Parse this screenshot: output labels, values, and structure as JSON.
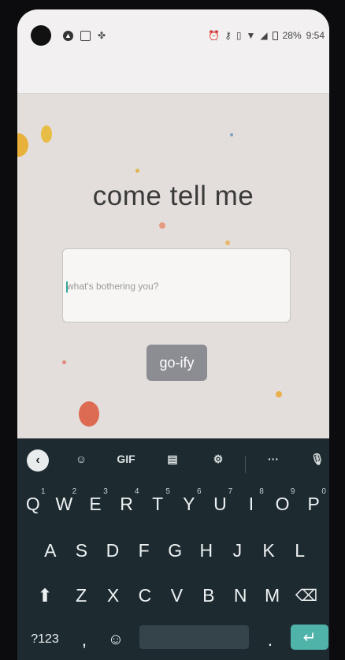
{
  "status_bar": {
    "battery": "28%",
    "time": "9:54",
    "left_icons": [
      "vpn-icon",
      "gallery-icon",
      "fan-icon"
    ],
    "right_icons": [
      "alarm-icon",
      "key-icon",
      "vibrate-icon",
      "wifi-icon",
      "signal-icon",
      "battery-icon"
    ]
  },
  "main": {
    "title": "come tell me",
    "input": {
      "placeholder": "what's bothering you?",
      "value": ""
    },
    "submit_label": "go-ify"
  },
  "keyboard": {
    "toolbar": [
      "back-icon",
      "sticker-icon",
      "GIF",
      "clipboard-icon",
      "gear-icon",
      "more-icon",
      "mic-icon"
    ],
    "gif_label": "GIF",
    "more_label": "···",
    "row1": [
      {
        "k": "Q",
        "n": "1"
      },
      {
        "k": "W",
        "n": "2"
      },
      {
        "k": "E",
        "n": "3"
      },
      {
        "k": "R",
        "n": "4"
      },
      {
        "k": "T",
        "n": "5"
      },
      {
        "k": "Y",
        "n": "6"
      },
      {
        "k": "U",
        "n": "7"
      },
      {
        "k": "I",
        "n": "8"
      },
      {
        "k": "O",
        "n": "9"
      },
      {
        "k": "P",
        "n": "0"
      }
    ],
    "row2": [
      "A",
      "S",
      "D",
      "F",
      "G",
      "H",
      "J",
      "K",
      "L"
    ],
    "row3": [
      "Z",
      "X",
      "C",
      "V",
      "B",
      "N",
      "M"
    ],
    "row4": {
      "symbols": "?123",
      "comma": ",",
      "period": "."
    }
  },
  "colors": {
    "accent": "#4fb3a9",
    "keyboard_bg": "#1d2b31",
    "button_bg": "#8c8d93",
    "paper": "#e3dedb"
  }
}
